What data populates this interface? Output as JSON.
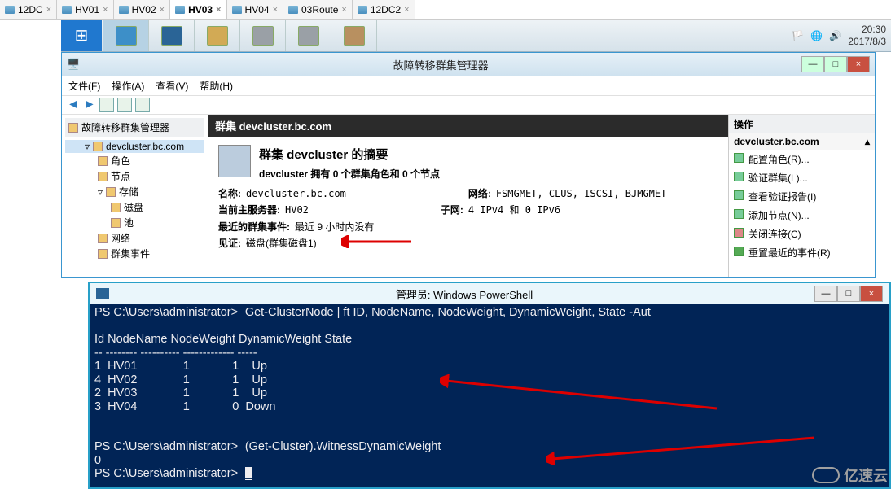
{
  "tabs": [
    {
      "label": "12DC"
    },
    {
      "label": "HV01"
    },
    {
      "label": "HV02"
    },
    {
      "label": "HV03",
      "active": true
    },
    {
      "label": "HV04"
    },
    {
      "label": "03Route"
    },
    {
      "label": "12DC2"
    }
  ],
  "clock": {
    "time": "20:30",
    "date": "2017/8/3"
  },
  "mainWindow": {
    "title": "故障转移群集管理器",
    "menu": [
      "文件(F)",
      "操作(A)",
      "查看(V)",
      "帮助(H)"
    ]
  },
  "tree": {
    "header": "故障转移群集管理器",
    "root": "devcluster.bc.com",
    "items": [
      "角色",
      "节点",
      "存储",
      "磁盘",
      "池",
      "网络",
      "群集事件"
    ]
  },
  "center": {
    "header": "群集 devcluster.bc.com",
    "summaryTitle": "群集 devcluster 的摘要",
    "summarySub": "devcluster 拥有 0 个群集角色和 0 个节点",
    "nameLabel": "名称:",
    "nameVal": "devcluster.bc.com",
    "netLabel": "网络:",
    "netVal": "FSMGMET, CLUS, ISCSI, BJMGMET",
    "hostLabel": "当前主服务器:",
    "hostVal": "HV02",
    "subnetLabel": "子网:",
    "subnetVal": "4 IPv4 和 0 IPv6",
    "eventLabel": "最近的群集事件:",
    "eventVal": "最近 9 小时内没有",
    "witnessLabel": "见证:",
    "witnessVal": "磁盘(群集磁盘1)"
  },
  "actions": {
    "header": "操作",
    "title": "devcluster.bc.com",
    "items": [
      "配置角色(R)...",
      "验证群集(L)...",
      "查看验证报告(I)",
      "添加节点(N)...",
      "关闭连接(C)",
      "重置最近的事件(R)"
    ]
  },
  "ps": {
    "title": "管理员: Windows PowerShell",
    "prompt": "PS C:\\Users\\administrator>",
    "cmd1": "Get-ClusterNode | ft ID, NodeName, NodeWeight, DynamicWeight, State -Aut",
    "headerRow": "Id NodeName NodeWeight DynamicWeight State",
    "dashRow": "-- -------- ---------- ------------- -----",
    "rows": [
      "1  HV01              1             1    Up",
      "4  HV02              1             1    Up",
      "2  HV03              1             1    Up",
      "3  HV04              1             0  Down"
    ],
    "cmd2": "(Get-Cluster).WitnessDynamicWeight",
    "result2": "0",
    "cursor": "_"
  },
  "watermark": "亿速云"
}
